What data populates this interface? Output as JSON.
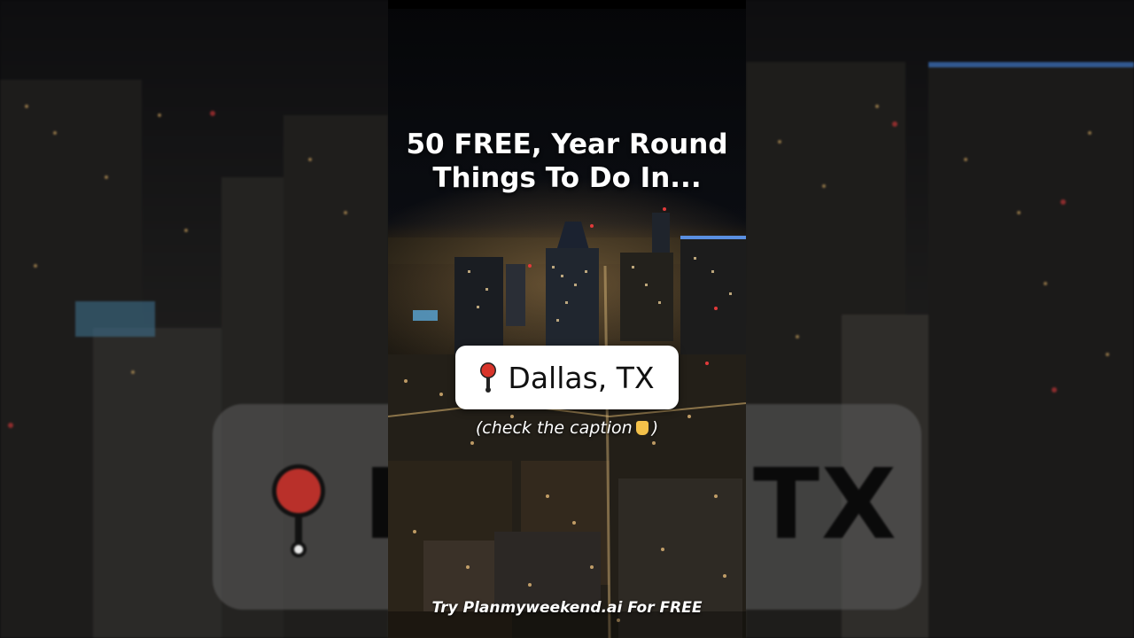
{
  "headline": {
    "line1": "50 FREE, Year Round",
    "line2": "Things To Do In..."
  },
  "location": {
    "pin_icon": "round-pushpin-icon",
    "name": "Dallas, TX",
    "pin_color": "#d8342a"
  },
  "caption_hint": {
    "open": "(check the caption",
    "icon": "pointing-down-hand-icon",
    "close": ")"
  },
  "cta": {
    "text": "Try Planmyweekend.ai For FREE"
  },
  "background": {
    "enlarged_text": "D",
    "enlarged_text_right": "TX"
  }
}
